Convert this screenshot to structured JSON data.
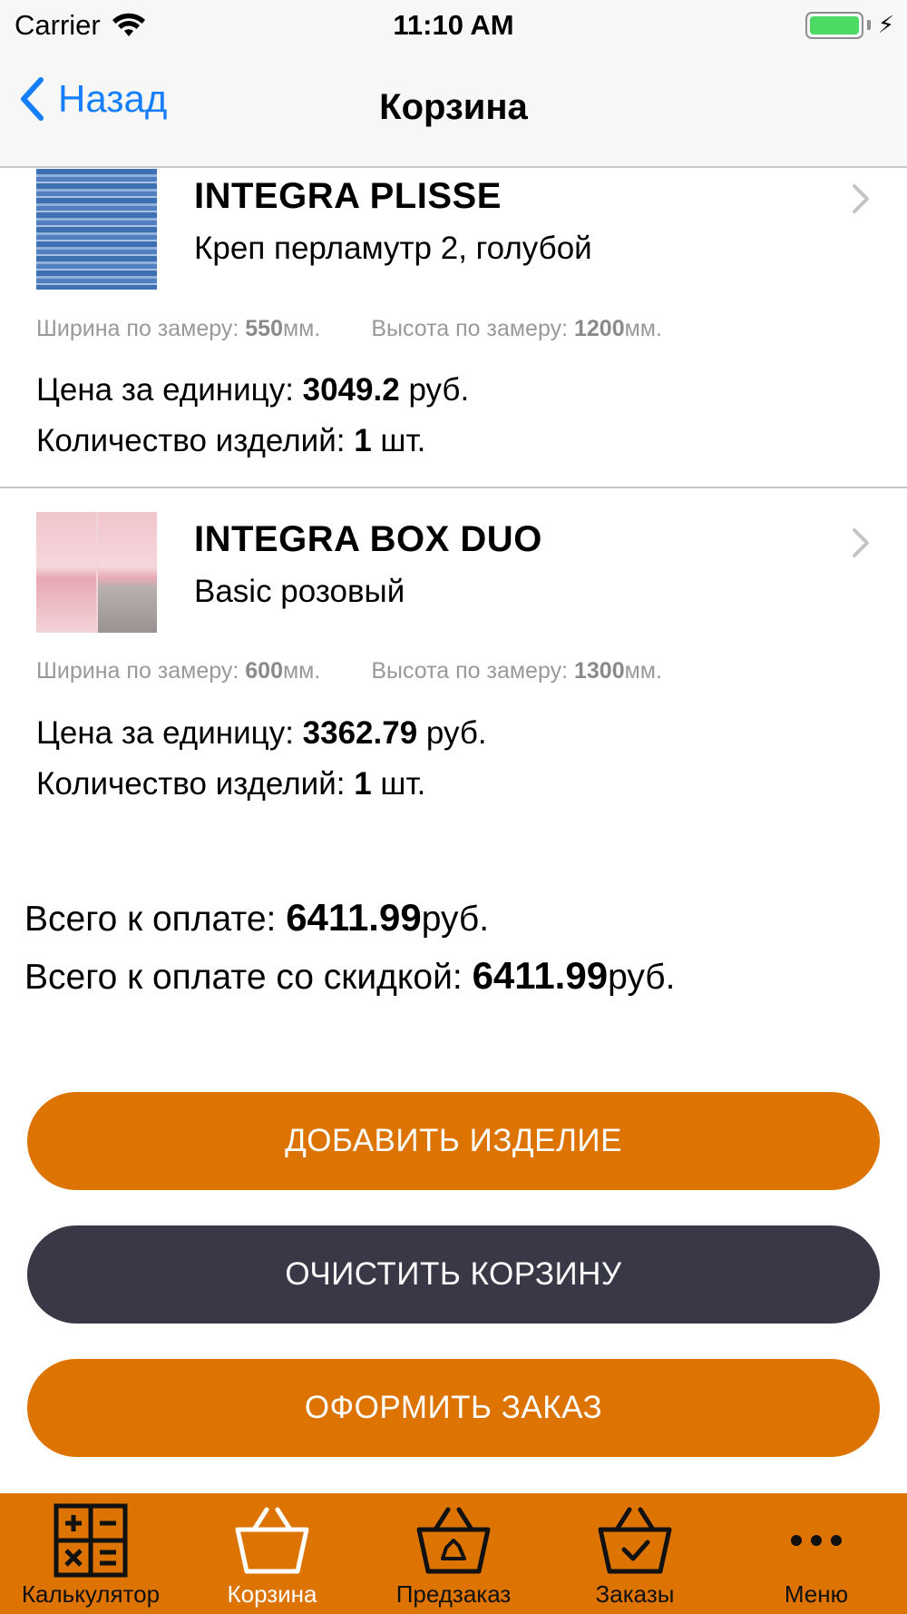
{
  "status_bar": {
    "carrier": "Carrier",
    "time": "11:10 AM"
  },
  "nav": {
    "back_label": "Назад",
    "title": "Корзина"
  },
  "items": [
    {
      "name": "INTEGRA PLISSE",
      "subtitle": "Креп перламутр 2, голубой",
      "width_label": "Ширина по замеру: ",
      "width_value": "550",
      "width_unit": "мм.",
      "height_label": "Высота по замеру: ",
      "height_value": "1200",
      "height_unit": "мм.",
      "price_label": "Цена за единицу: ",
      "price_value": "3049.2",
      "price_unit": " руб.",
      "qty_label": "Количество изделий: ",
      "qty_value": "1",
      "qty_unit": " шт."
    },
    {
      "name": "INTEGRA BOX DUO",
      "subtitle": "Basic розовый",
      "width_label": "Ширина по замеру: ",
      "width_value": "600",
      "width_unit": "мм.",
      "height_label": "Высота по замеру: ",
      "height_value": "1300",
      "height_unit": "мм.",
      "price_label": "Цена за единицу: ",
      "price_value": "3362.79",
      "price_unit": " руб.",
      "qty_label": "Количество изделий: ",
      "qty_value": "1",
      "qty_unit": " шт."
    }
  ],
  "totals": {
    "total_label": "Всего к оплате: ",
    "total_value": "6411.99",
    "total_unit": "руб.",
    "discount_label": "Всего к оплате со скидкой: ",
    "discount_value": "6411.99",
    "discount_unit": "руб."
  },
  "buttons": {
    "add": "ДОБАВИТЬ ИЗДЕЛИЕ",
    "clear": "ОЧИСТИТЬ КОРЗИНУ",
    "checkout": "ОФОРМИТЬ ЗАКАЗ"
  },
  "tabs": [
    {
      "label": "Калькулятор",
      "icon": "calculator-icon"
    },
    {
      "label": "Корзина",
      "icon": "basket-icon"
    },
    {
      "label": "Предзаказ",
      "icon": "basket-preorder-icon"
    },
    {
      "label": "Заказы",
      "icon": "basket-check-icon"
    },
    {
      "label": "Меню",
      "icon": "more-icon"
    }
  ],
  "colors": {
    "accent": "#dd7300",
    "dark_button": "#393846",
    "ios_blue": "#157efb",
    "battery": "#4cd964"
  }
}
